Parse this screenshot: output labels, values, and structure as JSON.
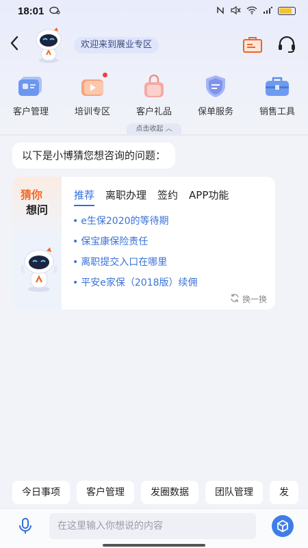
{
  "status_bar": {
    "time": "18:01",
    "battery_level": 0.8
  },
  "header": {
    "welcome": "欢迎来到展业专区"
  },
  "quick_nav": [
    {
      "label": "客户管理",
      "icon": "customer-card-icon"
    },
    {
      "label": "培训专区",
      "icon": "video-training-icon"
    },
    {
      "label": "客户礼品",
      "icon": "gift-bag-icon"
    },
    {
      "label": "保单服务",
      "icon": "policy-shield-icon"
    },
    {
      "label": "销售工具",
      "icon": "toolbox-icon"
    }
  ],
  "collapse_label": "点击收起",
  "greeting": "以下是小博猜您想咨询的问题：",
  "guess_card": {
    "title_line1": "猜你",
    "title_line2": "想问",
    "tabs": [
      "推荐",
      "离职办理",
      "签约",
      "APP功能"
    ],
    "active_tab": 0,
    "questions": [
      "e生保2020的等待期",
      "保宝康保险责任",
      "离职提交入口在哪里",
      "平安e家保（2018版）续佣"
    ],
    "refresh_label": "换一换"
  },
  "chips": [
    "今日事项",
    "客户管理",
    "发圈数据",
    "团队管理",
    "发"
  ],
  "input": {
    "placeholder": "在这里输入你想说的内容"
  },
  "colors": {
    "accent_blue": "#2f6fe0",
    "orange": "#f06a2a",
    "background": "#f1f3f8"
  }
}
